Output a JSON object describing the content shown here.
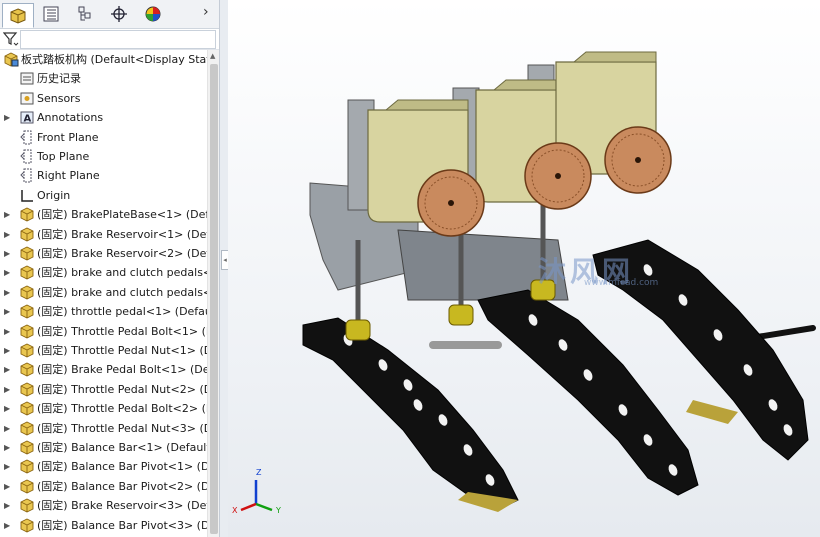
{
  "tabs": [
    {
      "name": "feature-manager-tab",
      "icon": "feature-manager-icon"
    },
    {
      "name": "property-manager-tab",
      "icon": "property-manager-icon"
    },
    {
      "name": "configuration-manager-tab",
      "icon": "configuration-manager-icon"
    },
    {
      "name": "dimxpert-manager-tab",
      "icon": "crosshair-icon"
    },
    {
      "name": "display-manager-tab",
      "icon": "appearance-icon"
    }
  ],
  "tree": {
    "root": "板式踏板机构  (Default<Display State",
    "items": [
      {
        "label": "历史记录",
        "icon": "history-icon",
        "expandable": false
      },
      {
        "label": "Sensors",
        "icon": "sensors-icon",
        "expandable": false
      },
      {
        "label": "Annotations",
        "icon": "annotations-icon",
        "expandable": true
      },
      {
        "label": "Front Plane",
        "icon": "plane-icon",
        "expandable": false
      },
      {
        "label": "Top Plane",
        "icon": "plane-icon",
        "expandable": false
      },
      {
        "label": "Right Plane",
        "icon": "plane-icon",
        "expandable": false
      },
      {
        "label": "Origin",
        "icon": "origin-icon",
        "expandable": false
      },
      {
        "label": "(固定) BrakePlateBase<1> (Defa",
        "icon": "part-icon",
        "expandable": true
      },
      {
        "label": "(固定) Brake Reservoir<1> (Defa",
        "icon": "part-icon",
        "expandable": true
      },
      {
        "label": "(固定) Brake Reservoir<2> (Defa",
        "icon": "part-icon",
        "expandable": true
      },
      {
        "label": "(固定) brake and clutch pedals<",
        "icon": "part-icon",
        "expandable": true
      },
      {
        "label": "(固定) brake and clutch pedals<",
        "icon": "part-icon",
        "expandable": true
      },
      {
        "label": "(固定) throttle pedal<1> (Default",
        "icon": "part-icon",
        "expandable": true
      },
      {
        "label": "(固定) Throttle Pedal Bolt<1> (D",
        "icon": "part-icon",
        "expandable": true
      },
      {
        "label": "(固定) Throttle Pedal Nut<1> (De",
        "icon": "part-icon",
        "expandable": true
      },
      {
        "label": "(固定) Brake Pedal Bolt<1> (Def",
        "icon": "part-icon",
        "expandable": true
      },
      {
        "label": "(固定) Throttle Pedal Nut<2> (De",
        "icon": "part-icon",
        "expandable": true
      },
      {
        "label": "(固定) Throttle Pedal Bolt<2> (D",
        "icon": "part-icon",
        "expandable": true
      },
      {
        "label": "(固定) Throttle Pedal Nut<3> (De",
        "icon": "part-icon",
        "expandable": true
      },
      {
        "label": "(固定) Balance Bar<1> (Default<",
        "icon": "part-icon",
        "expandable": true
      },
      {
        "label": "(固定) Balance Bar Pivot<1> (De",
        "icon": "part-icon",
        "expandable": true
      },
      {
        "label": "(固定) Balance Bar Pivot<2> (De",
        "icon": "part-icon",
        "expandable": true
      },
      {
        "label": "(固定) Brake Reservoir<3> (Defa",
        "icon": "part-icon",
        "expandable": true
      },
      {
        "label": "(固定) Balance Bar Pivot<3> (De",
        "icon": "part-icon",
        "expandable": true
      }
    ]
  },
  "watermark": {
    "title": "沐风网",
    "url": "www.mfcad.com"
  },
  "triad": {
    "x": "X",
    "y": "Y",
    "z": "Z"
  },
  "colors": {
    "pedal": "#111111",
    "reservoir": "#d8d4a0",
    "knob": "#c98a5e",
    "bolt": "#c8b820",
    "axis_x": "#d01010",
    "axis_y": "#10a010",
    "axis_z": "#1040d0"
  }
}
